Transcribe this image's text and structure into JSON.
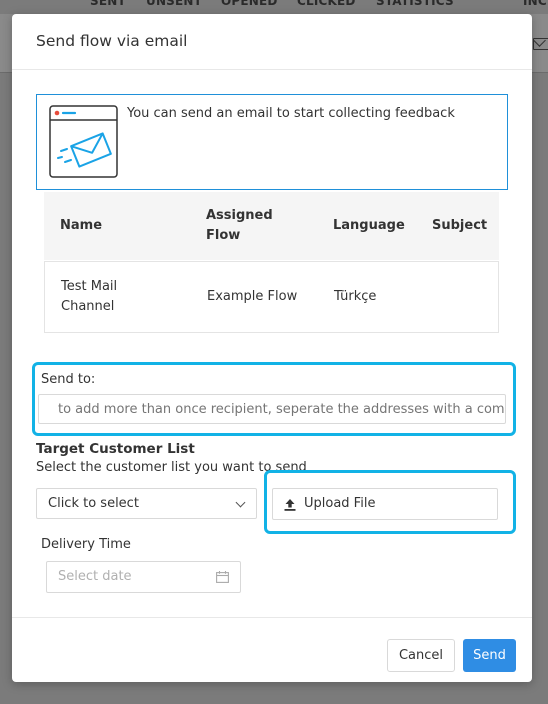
{
  "background": {
    "columns": [
      "SENT",
      "UNSENT",
      "OPENED",
      "CLICKED",
      "STATISTICS",
      "INC"
    ]
  },
  "modal": {
    "title": "Send flow via email",
    "info_text": "You can send an email to start collecting feedback",
    "table": {
      "headers": {
        "name": "Name",
        "assigned_flow_1": "Assigned",
        "assigned_flow_2": "Flow",
        "language": "Language",
        "subject": "Subject"
      },
      "row": {
        "name_1": "Test Mail",
        "name_2": "Channel",
        "assigned_flow": "Example Flow",
        "language": "Türkçe",
        "subject": ""
      }
    },
    "send_to": {
      "label": "Send to:",
      "placeholder": "to add more than once recipient, seperate the addresses with a comma"
    },
    "target": {
      "title": "Target Customer List",
      "subtitle": "Select the customer list you want to send",
      "select_value": "Click to select",
      "upload_label": "Upload File"
    },
    "delivery": {
      "label": "Delivery Time",
      "placeholder": "Select date"
    },
    "footer": {
      "cancel_label": "Cancel",
      "send_label": "Send"
    }
  },
  "colors": {
    "accent": "#2f8de4",
    "highlight": "#12b2e6",
    "info_border": "#1f90d9"
  }
}
